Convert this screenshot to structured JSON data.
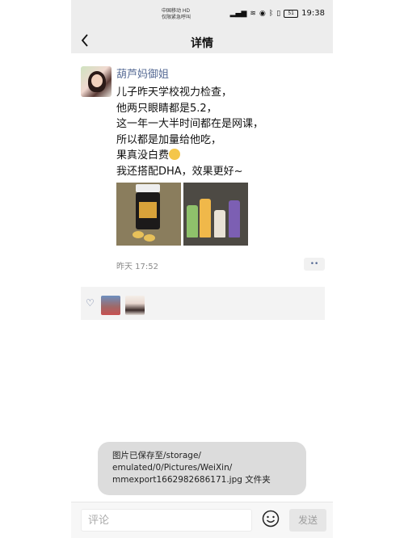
{
  "status_bar": {
    "carrier_line1": "中国移动 HD",
    "carrier_line2": "仅限紧急呼叫",
    "time": "19:38",
    "battery": "51"
  },
  "nav": {
    "back_icon": "chevron-left-icon",
    "title": "详情"
  },
  "post": {
    "username": "葫芦妈御姐",
    "lines": [
      "儿子昨天学校视力检查，",
      "他两只眼睛都是5.2，",
      "这一年一大半时间都在是网课，",
      "所以都是加量给他吃，",
      "果真没白费",
      "我还搭配DHA，效果更好~"
    ],
    "timestamp": "昨天 17:52",
    "more_label": "••"
  },
  "likes": {
    "icon": "heart-icon"
  },
  "toast": {
    "lines": [
      "图片已保存至/storage/",
      "emulated/0/Pictures/WeiXin/",
      "mmexport1662982686171.jpg 文件夹"
    ]
  },
  "comment_bar": {
    "placeholder": "评论",
    "emoji_icon": "smiley-icon",
    "send_label": "发送"
  }
}
